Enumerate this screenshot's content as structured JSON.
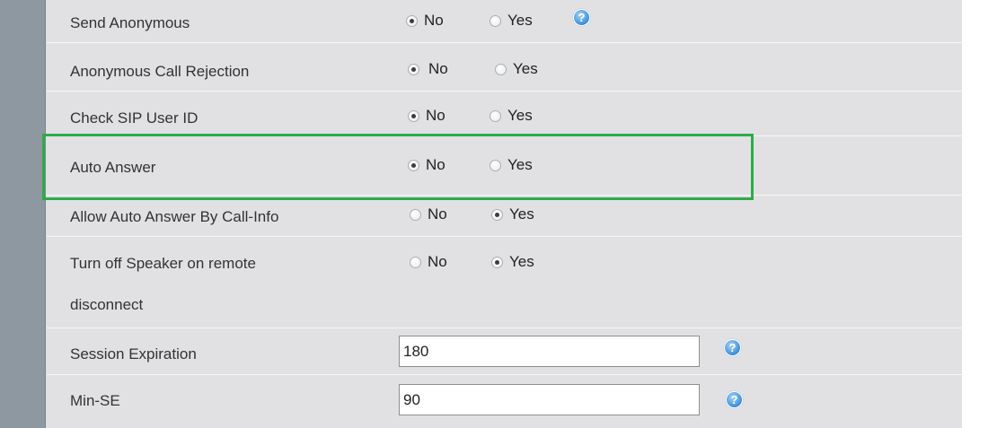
{
  "colors": {
    "panel_bg": "#e1e1e3",
    "left_bar": "#8e98a0",
    "highlight": "#2dab4a",
    "help_icon": "#3b8fd6"
  },
  "rows": [
    {
      "label": "Send Anonymous",
      "no_label": "No",
      "yes_label": "Yes",
      "selected": "No",
      "help_icon": "help-icon"
    },
    {
      "label": "Anonymous Call Rejection",
      "no_label": "No",
      "yes_label": "Yes",
      "selected": "No"
    },
    {
      "label": "Check SIP User ID",
      "no_label": "No",
      "yes_label": "Yes",
      "selected": "No"
    },
    {
      "label": "Auto Answer",
      "no_label": "No",
      "yes_label": "Yes",
      "selected": "No",
      "highlighted": true
    },
    {
      "label": "Allow Auto Answer By Call-Info",
      "no_label": "No",
      "yes_label": "Yes",
      "selected": "Yes"
    },
    {
      "label_line1": "Turn off Speaker on remote",
      "label_line2": "disconnect",
      "no_label": "No",
      "yes_label": "Yes",
      "selected": "Yes"
    },
    {
      "label": "Session Expiration",
      "value": "180",
      "help_icon": "help-icon"
    },
    {
      "label": "Min-SE",
      "value": "90",
      "help_icon": "help-icon"
    }
  ],
  "help_glyph": "?"
}
